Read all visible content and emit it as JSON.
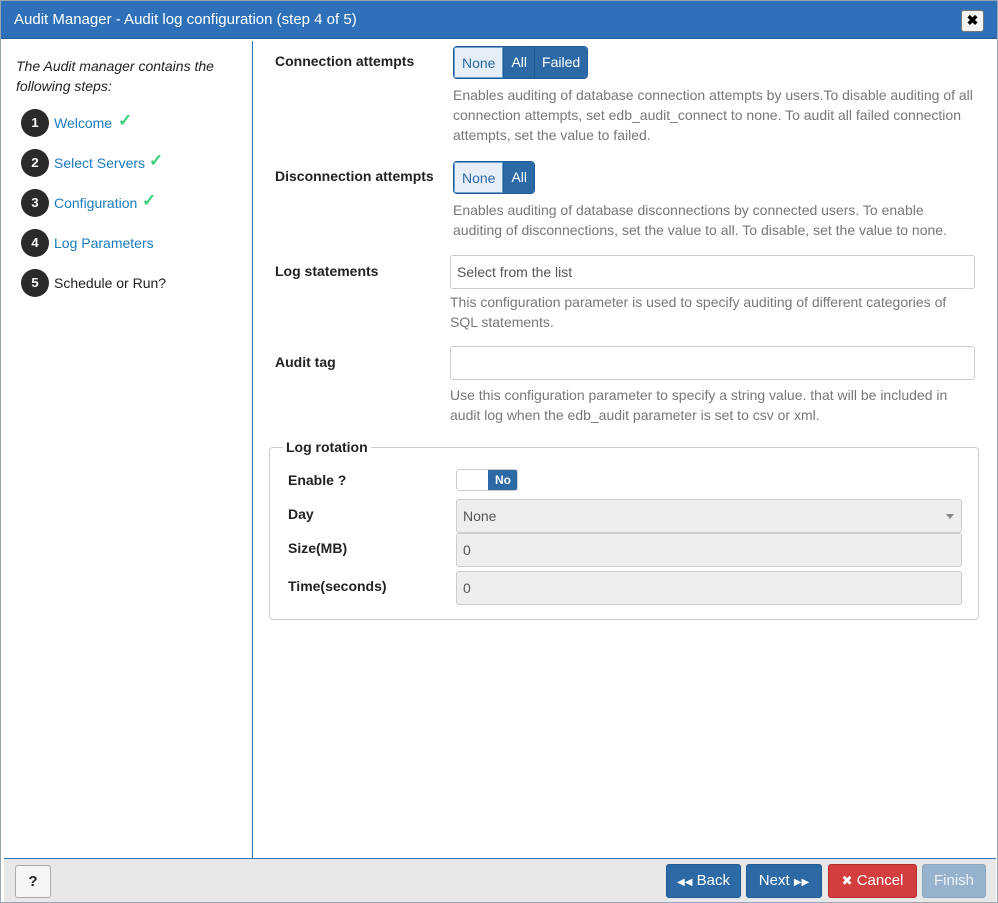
{
  "window": {
    "title": "Audit Manager - Audit log configuration (step 4 of 5)",
    "close_symbol": "✖"
  },
  "sidebar": {
    "intro": "The Audit manager contains the following steps:",
    "steps": [
      {
        "number": "1",
        "label": "Welcome",
        "done": true
      },
      {
        "number": "2",
        "label": "Select Servers",
        "done": true
      },
      {
        "number": "3",
        "label": "Configuration",
        "done": true
      },
      {
        "number": "4",
        "label": "Log Parameters",
        "done": false
      },
      {
        "number": "5",
        "label": "Schedule or Run?",
        "done": false
      }
    ],
    "check_symbol": "✓"
  },
  "form": {
    "connection": {
      "label": "Connection attempts",
      "options": [
        "None",
        "All",
        "Failed"
      ],
      "selected": "None",
      "help": "Enables auditing of database connection attempts by users.To disable auditing of all connection attempts, set edb_audit_connect to none. To audit all failed connection attempts, set the value to failed."
    },
    "disconnection": {
      "label": "Disconnection attempts",
      "options": [
        "None",
        "All"
      ],
      "selected": "None",
      "help": "Enables auditing of database disconnections by connected users. To enable auditing of disconnections, set the value to all. To disable, set the value to none."
    },
    "log_statements": {
      "label": "Log statements",
      "placeholder": "Select from the list",
      "help": "This configuration parameter is used to specify auditing of different categories of SQL statements."
    },
    "audit_tag": {
      "label": "Audit tag",
      "value": "",
      "help": "Use this configuration parameter to specify a string value. that will be included in audit log when the edb_audit parameter is set to csv or xml."
    },
    "log_rotation": {
      "legend": "Log rotation",
      "enable_label": "Enable ?",
      "enable_value": "No",
      "day_label": "Day",
      "day_value": "None",
      "size_label": "Size(MB)",
      "size_value": "0",
      "time_label": "Time(seconds)",
      "time_value": "0"
    }
  },
  "footer": {
    "help_label": "?",
    "back_label": "Back",
    "back_icon": "◀◀",
    "next_label": "Next",
    "next_icon": "▶▶",
    "cancel_label": "Cancel",
    "cancel_icon": "✖",
    "finish_label": "Finish"
  },
  "colors": {
    "titlebar": "#2f71b8",
    "primary": "#2d6aa5",
    "danger": "#d33f3f",
    "check": "#3ccf7a",
    "link": "#1a7bbf"
  }
}
